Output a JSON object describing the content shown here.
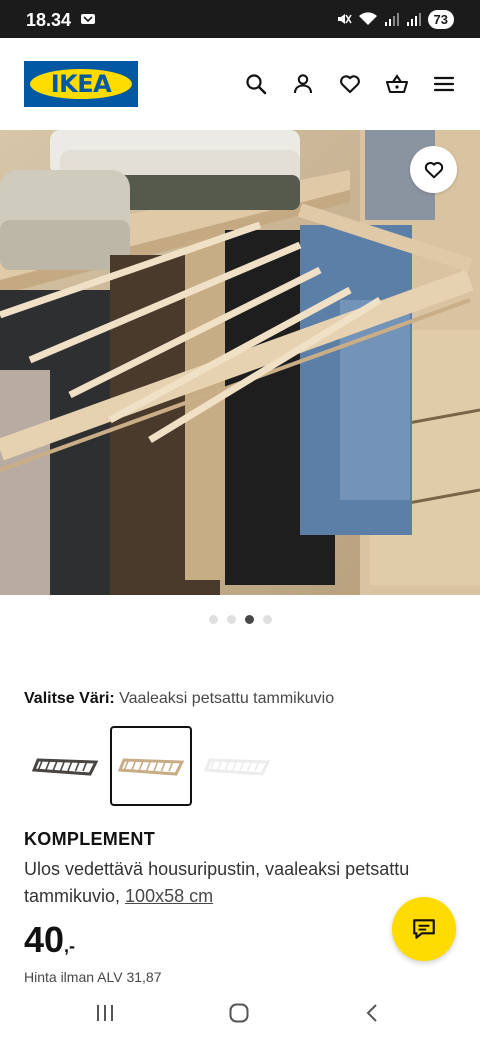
{
  "status_bar": {
    "time": "18.34",
    "battery": "73",
    "icons": [
      "message-icon",
      "mute-icon",
      "wifi-icon",
      "signal-icon",
      "signal-icon",
      "battery-badge"
    ]
  },
  "header": {
    "logo_text": "IKEA",
    "icons": [
      "search-icon",
      "account-icon",
      "heart-icon",
      "basket-icon",
      "menu-icon"
    ]
  },
  "carousel": {
    "slide_count": 4,
    "active_index": 2,
    "favourite_icon": "heart-icon"
  },
  "color_selector": {
    "label": "Valitse Väri:",
    "value": "Vaaleaksi petsattu tammikuvio",
    "variants": [
      {
        "color": "#4a4440",
        "selected": false
      },
      {
        "color": "#c7ac85",
        "selected": true
      },
      {
        "color": "#ececec",
        "selected": false
      }
    ]
  },
  "product": {
    "name": "KOMPLEMENT",
    "description": "Ulos vedettävä housuripustin, vaaleaksi petsattu tammikuvio,",
    "size": "100x58 cm",
    "price_integer": "40",
    "price_suffix": ",-",
    "price_note": "Hinta ilman ALV 31,87"
  },
  "chat_button": {
    "icon": "chat-icon"
  },
  "nav_bar": {
    "icons": [
      "recent-apps-icon",
      "home-icon",
      "back-icon"
    ]
  },
  "colors": {
    "ikea_blue": "#0058a3",
    "ikea_yellow": "#ffdb00"
  }
}
